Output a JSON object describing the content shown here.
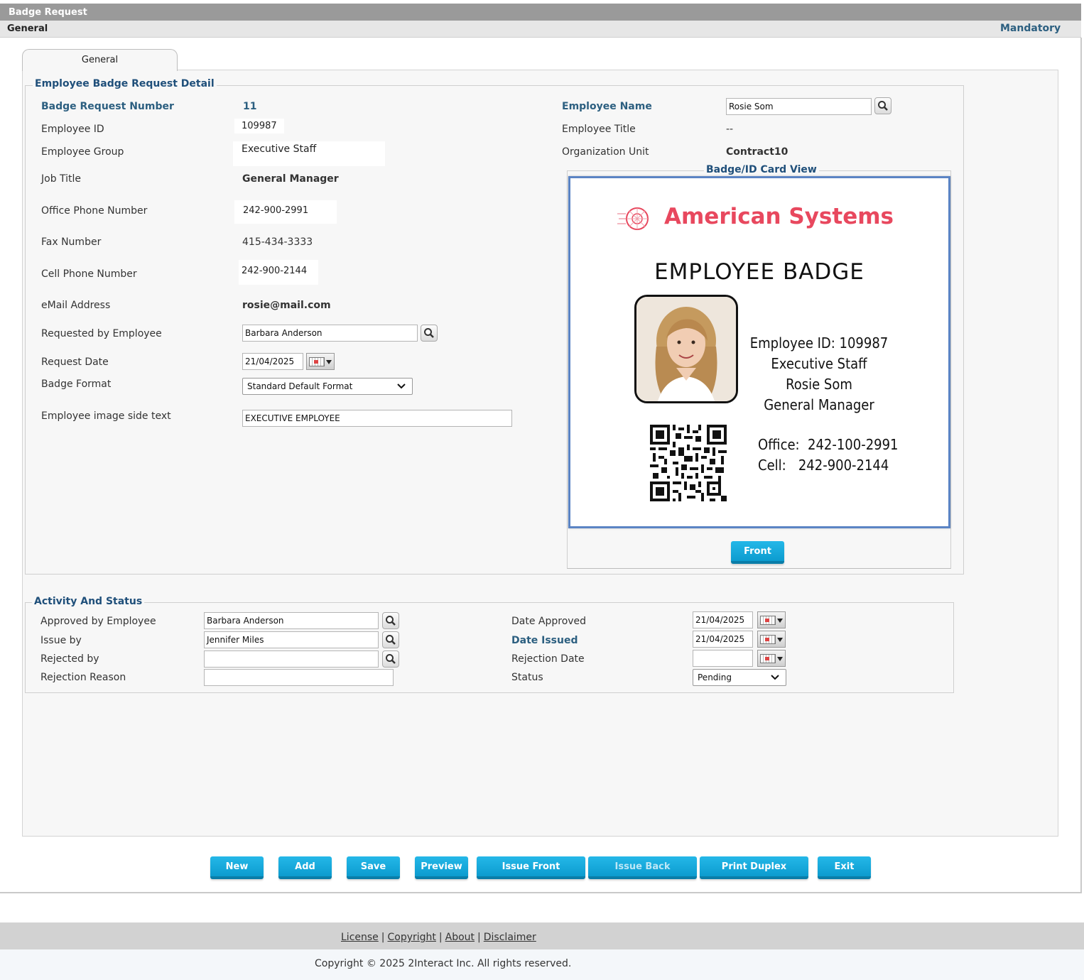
{
  "window": {
    "title": "Badge Request"
  },
  "subheader": {
    "section": "General",
    "mandatory_label": "Mandatory"
  },
  "tabs": [
    {
      "label": "General"
    }
  ],
  "detail": {
    "legend": "Employee Badge Request Detail",
    "badge_request_number_label": "Badge Request Number",
    "badge_request_number": "11",
    "employee_id_label": "Employee ID",
    "employee_id": "109987",
    "employee_group_label": "Employee Group",
    "employee_group": "Executive Staff",
    "job_title_label": "Job Title",
    "job_title": "General Manager",
    "office_phone_label": "Office Phone Number",
    "office_phone": "242-900-2991",
    "fax_label": "Fax Number",
    "fax": "415-434-3333",
    "cell_phone_label": "Cell Phone Number",
    "cell_phone": "242-900-2144",
    "email_label": "eMail Address",
    "email": "rosie@mail.com",
    "requested_by_label": "Requested by Employee",
    "requested_by": "Barbara Anderson",
    "request_date_label": "Request Date",
    "request_date": "21/04/2025",
    "badge_format_label": "Badge Format",
    "badge_format": "Standard Default Format",
    "image_side_text_label": "Employee image side text",
    "image_side_text": "EXECUTIVE EMPLOYEE",
    "employee_name_label": "Employee Name",
    "employee_name": "Rosie Som",
    "employee_title_label": "Employee Title",
    "employee_title": "--",
    "org_unit_label": "Organization Unit",
    "org_unit": "Contract10"
  },
  "card_view": {
    "legend": "Badge/ID Card View",
    "company": "American Systems",
    "heading": "EMPLOYEE BADGE",
    "lines": [
      "Employee ID: 109987",
      "Executive Staff",
      "Rosie Som",
      "General Manager"
    ],
    "office_label": "Office:",
    "office": "242-100-2991",
    "cell_label": "Cell:",
    "cell": "242-900-2144",
    "front_button": "Front",
    "brand_color": "#e8485e"
  },
  "activity": {
    "legend": "Activity And Status",
    "approved_by_label": "Approved by Employee",
    "approved_by": "Barbara Anderson",
    "issue_by_label": "Issue by",
    "issue_by": "Jennifer Miles",
    "rejected_by_label": "Rejected by",
    "rejected_by": "",
    "rejection_reason_label": "Rejection Reason",
    "rejection_reason": "",
    "date_approved_label": "Date Approved",
    "date_approved": "21/04/2025",
    "date_issued_label": "Date Issued",
    "date_issued": "21/04/2025",
    "rejection_date_label": "Rejection Date",
    "rejection_date": "",
    "status_label": "Status",
    "status": "Pending"
  },
  "actions": {
    "new": "New",
    "add": "Add",
    "save": "Save",
    "preview": "Preview",
    "issue_front": "Issue Front",
    "issue_back": "Issue Back",
    "print_duplex": "Print Duplex",
    "exit": "Exit"
  },
  "footer": {
    "links": [
      "License",
      "Copyright",
      "About",
      "Disclaimer"
    ],
    "copyright": "Copyright © 2025 2Interact Inc. All rights reserved."
  },
  "colors": {
    "accent_button": "#12a8db",
    "label_blue": "#2c5f80",
    "card_border": "#5b84c4"
  }
}
